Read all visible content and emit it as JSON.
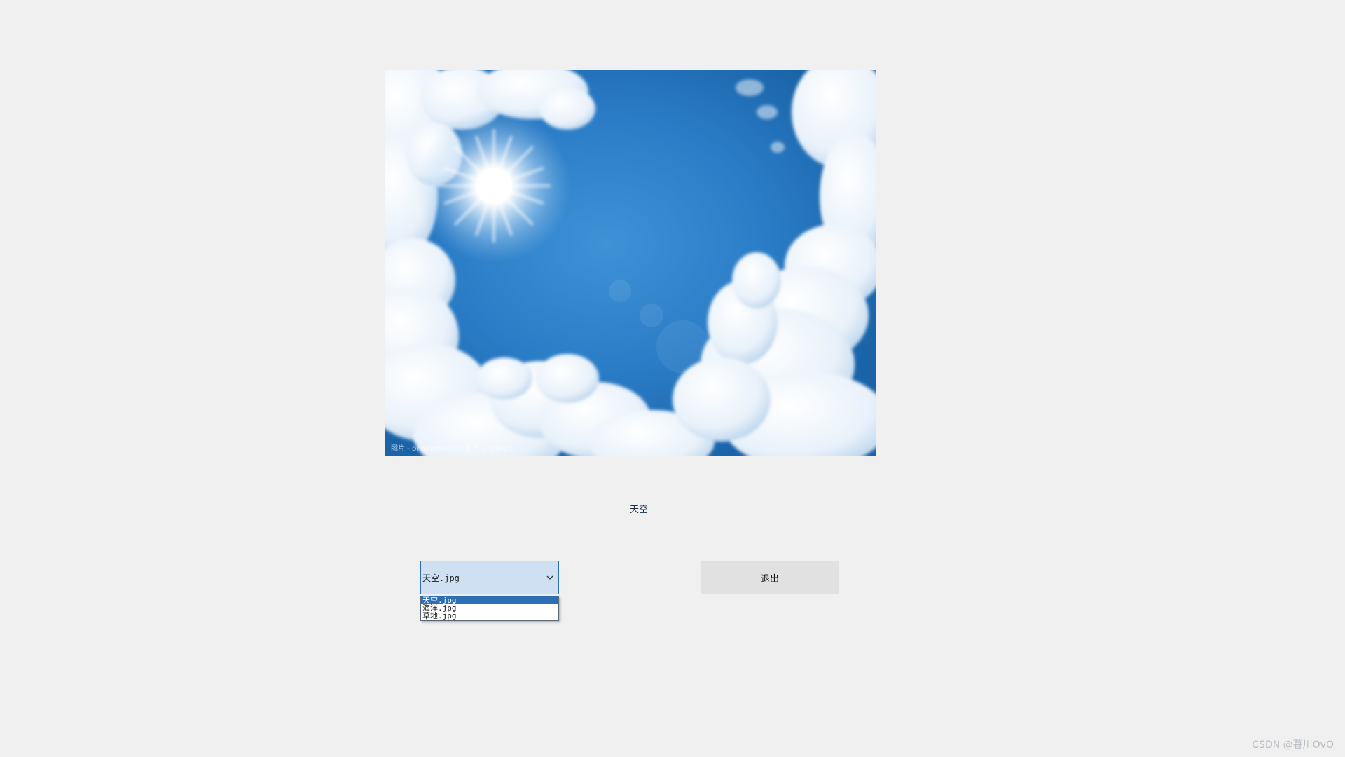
{
  "picture": {
    "description_icon": "sky-photo-icon",
    "credit_text": "图片 - photophoto.cn 编号 2789925",
    "colors": {
      "sky_deep": "#1f6fb8",
      "sky_light": "#4a98d8",
      "cloud": "#ffffff",
      "cloud_shadow": "#c9dcef"
    }
  },
  "caption": {
    "text": "天空"
  },
  "combo": {
    "selected_value": "天空.jpg",
    "arrow_icon": "chevron-down-icon",
    "options": [
      "天空.jpg",
      "海洋.jpg",
      "草地.jpg"
    ]
  },
  "exit_button": {
    "label": "退出"
  },
  "watermark": {
    "text": "CSDN @暮川OvO"
  }
}
